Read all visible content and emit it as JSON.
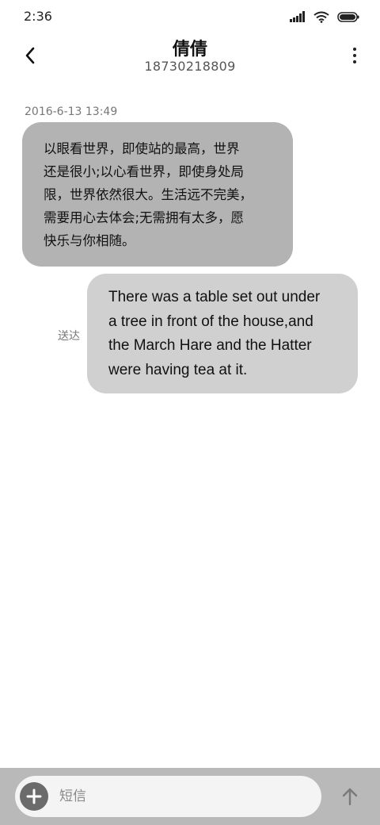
{
  "status_bar": {
    "time": "2:36",
    "icons": [
      "signal-icon",
      "wifi-icon",
      "battery-icon"
    ]
  },
  "header": {
    "contact_name": "倩倩",
    "contact_number": "18730218809",
    "back_icon": "chevron-left-icon",
    "more_icon": "more-vertical-icon"
  },
  "conversation": {
    "timestamp": "2016-6-13 13:49",
    "messages": [
      {
        "direction": "incoming",
        "text": "以眼看世界，即使站的最高，世界\n还是很小;以心看世界，即使身处局\n限，世界依然很大。生活远不完美，\n需要用心去体会;无需拥有太多，愿\n快乐与你相随。"
      },
      {
        "direction": "outgoing",
        "text": "There was a table set out under\na tree in front of the house,and\nthe March Hare and the Hatter\nwere having tea at it.",
        "status": "送达"
      }
    ]
  },
  "input_bar": {
    "placeholder": "短信",
    "add_icon": "plus-icon",
    "send_icon": "arrow-up-icon"
  },
  "colors": {
    "incoming_bubble": "#b3b3b3",
    "outgoing_bubble": "#d0d0d0",
    "input_bar_bg": "#b9b9b9",
    "add_button": "#6b6b6b"
  }
}
